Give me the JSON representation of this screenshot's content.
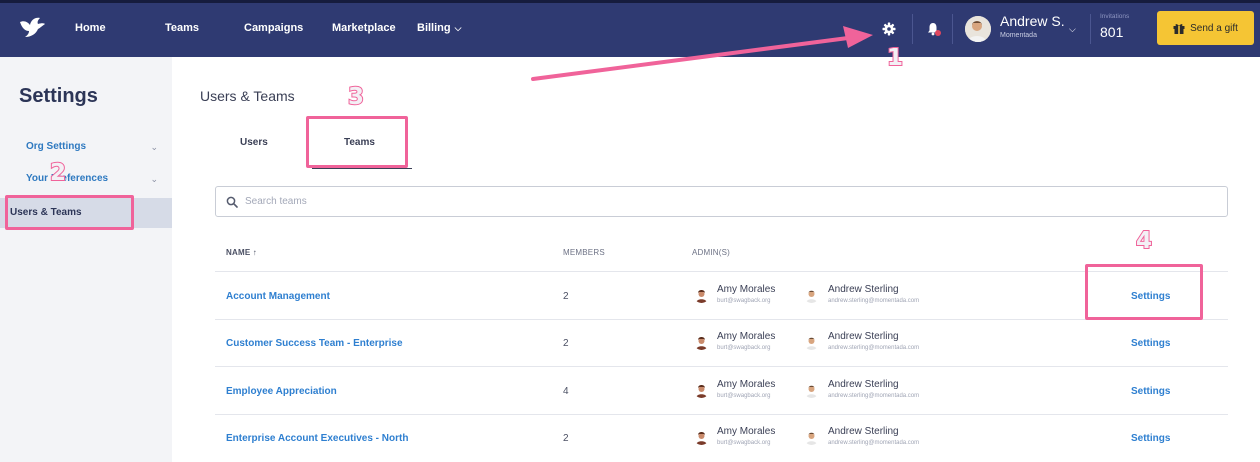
{
  "topbar": {
    "nav": [
      {
        "label": "Home"
      },
      {
        "label": "Teams"
      },
      {
        "label": "Campaigns"
      },
      {
        "label": "Marketplace"
      },
      {
        "label": "Billing"
      }
    ],
    "user": {
      "name": "Andrew S.",
      "org": "Momentada"
    },
    "invitations": {
      "label": "Invitations",
      "count": "801"
    },
    "gift_button": "Send a gift",
    "bg_color": "#2f3a72",
    "gift_color": "#f5c534"
  },
  "sidebar": {
    "title": "Settings",
    "items": [
      {
        "label": "Org Settings",
        "expandable": true
      },
      {
        "label": "Your Preferences",
        "expandable": true
      },
      {
        "label": "Users & Teams",
        "active": true
      }
    ]
  },
  "main": {
    "heading": "Users & Teams",
    "tabs": [
      {
        "label": "Users"
      },
      {
        "label": "Teams",
        "active": true
      }
    ],
    "search_placeholder": "Search teams",
    "columns": {
      "name": "NAME ↑",
      "members": "MEMBERS",
      "admins": "ADMIN(S)"
    },
    "rows": [
      {
        "name": "Account Management",
        "members": "2",
        "admin1": {
          "name": "Amy Morales",
          "email": "burt@swagback.org"
        },
        "admin2": {
          "name": "Andrew Sterling",
          "email": "andrew.sterling@momentada.com"
        },
        "action": "Settings"
      },
      {
        "name": "Customer Success Team - Enterprise",
        "members": "2",
        "admin1": {
          "name": "Amy Morales",
          "email": "burt@swagback.org"
        },
        "admin2": {
          "name": "Andrew Sterling",
          "email": "andrew.sterling@momentada.com"
        },
        "action": "Settings"
      },
      {
        "name": "Employee Appreciation",
        "members": "4",
        "admin1": {
          "name": "Amy Morales",
          "email": "burt@swagback.org"
        },
        "admin2": {
          "name": "Andrew Sterling",
          "email": "andrew.sterling@momentada.com"
        },
        "action": "Settings"
      },
      {
        "name": "Enterprise Account Executives - North",
        "members": "2",
        "admin1": {
          "name": "Amy Morales",
          "email": "burt@swagback.org"
        },
        "admin2": {
          "name": "Andrew Sterling",
          "email": "andrew.sterling@momentada.com"
        },
        "action": "Settings"
      }
    ],
    "link_color": "#2e7fd0"
  },
  "annotations": {
    "steps": [
      "1",
      "2",
      "3",
      "4"
    ],
    "color": "#f0639a"
  }
}
